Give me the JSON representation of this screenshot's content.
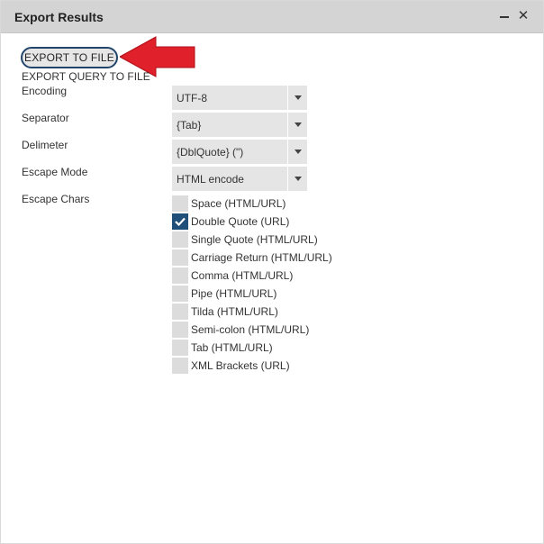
{
  "window": {
    "title": "Export Results",
    "minimize_icon": "minimize-icon",
    "close_glyph": "✕"
  },
  "actions": {
    "export_to_file": "EXPORT TO FILE",
    "export_query_to_file": "EXPORT QUERY TO FILE",
    "annotation": "red-arrow-pointing-left"
  },
  "form": {
    "encoding": {
      "label": "Encoding",
      "value": "UTF-8"
    },
    "separator": {
      "label": "Separator",
      "value": "{Tab}"
    },
    "delimeter": {
      "label": "Delimeter",
      "value": "{DblQuote} (\")"
    },
    "escape_mode": {
      "label": "Escape Mode",
      "value": "HTML encode"
    },
    "escape_chars": {
      "label": "Escape Chars",
      "options": [
        {
          "label": "Space (HTML/URL)",
          "checked": false
        },
        {
          "label": "Double Quote (URL)",
          "checked": true
        },
        {
          "label": "Single Quote (HTML/URL)",
          "checked": false
        },
        {
          "label": "Carriage Return (HTML/URL)",
          "checked": false
        },
        {
          "label": "Comma (HTML/URL)",
          "checked": false
        },
        {
          "label": "Pipe (HTML/URL)",
          "checked": false
        },
        {
          "label": "Tilda (HTML/URL)",
          "checked": false
        },
        {
          "label": "Semi-colon (HTML/URL)",
          "checked": false
        },
        {
          "label": "Tab (HTML/URL)",
          "checked": false
        },
        {
          "label": "XML Brackets (URL)",
          "checked": false
        }
      ]
    }
  },
  "colors": {
    "titlebar": "#d4d4d4",
    "checked": "#1f4e79",
    "arrow": "#e0202a"
  }
}
